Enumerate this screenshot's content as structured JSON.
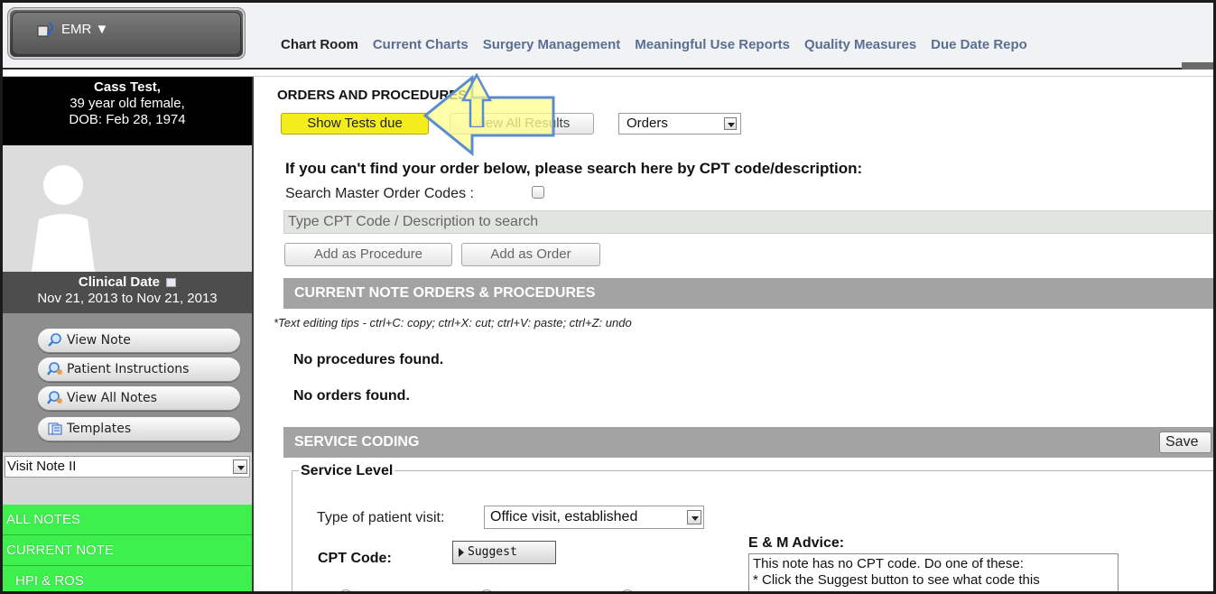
{
  "topbar": {
    "emr_label": "EMR ▼",
    "tabs": [
      {
        "label": "Chart Room",
        "active": true
      },
      {
        "label": "Current Charts",
        "active": false
      },
      {
        "label": "Surgery Management",
        "active": false
      },
      {
        "label": "Meaningful Use Reports",
        "active": false
      },
      {
        "label": "Quality Measures",
        "active": false
      },
      {
        "label": "Due Date Repo",
        "active": false
      }
    ]
  },
  "sidebar": {
    "patient": {
      "name": "Cass Test,",
      "age_sex": "39 year old female,",
      "dob": "DOB: Feb 28, 1974"
    },
    "clinical": {
      "title": "Clinical Date",
      "range": "Nov 21, 2013 to Nov 21, 2013"
    },
    "buttons": [
      {
        "label": "View Note",
        "icon": "magnifier-icon"
      },
      {
        "label": "Patient Instructions",
        "icon": "magnifier-people-icon"
      },
      {
        "label": "View All Notes",
        "icon": "magnifier-people-icon"
      },
      {
        "label": "Templates",
        "icon": "templates-icon"
      }
    ],
    "note_select": "Visit Note II",
    "notes": [
      {
        "label": "ALL NOTES"
      },
      {
        "label": "CURRENT NOTE"
      },
      {
        "label": "HPI & ROS"
      }
    ]
  },
  "main": {
    "section_title": "ORDERS AND PROCEDURES",
    "show_tests_label": "Show Tests due",
    "view_results_label": "View All Results",
    "orders_select": "Orders",
    "search_heading": "If you can't find your order below, please search here by CPT code/description:",
    "master_label": "Search Master Order Codes :",
    "search_placeholder": "Type CPT Code / Description to search",
    "add_procedure_label": "Add as Procedure",
    "add_order_label": "Add as Order",
    "current_bar": "CURRENT NOTE ORDERS & PROCEDURES",
    "tips": "*Text editing tips - ctrl+C: copy; ctrl+X: cut; ctrl+V: paste; ctrl+Z: undo",
    "no_procedures": "No procedures found.",
    "no_orders": "No orders found.",
    "service_bar": "SERVICE CODING",
    "save_label": "Save",
    "service_level": "Service Level",
    "visit_type_label": "Type of patient visit:",
    "visit_type_value": "Office visit, established",
    "cpt_code_label": "CPT Code:",
    "suggest_label": "Suggest",
    "em_advice_label": "E & M Advice:",
    "em_advice_text": "This note has no CPT code. Do one of these:\n* Click the Suggest button to see what code this"
  },
  "colors": {
    "highlight_button": "#f3ed1e",
    "notes_green": "#3df04d",
    "section_bar_gray": "#a3a3a3",
    "nav_link_blue": "#5a6f94",
    "annotation_arrow": "#ffff8c"
  }
}
